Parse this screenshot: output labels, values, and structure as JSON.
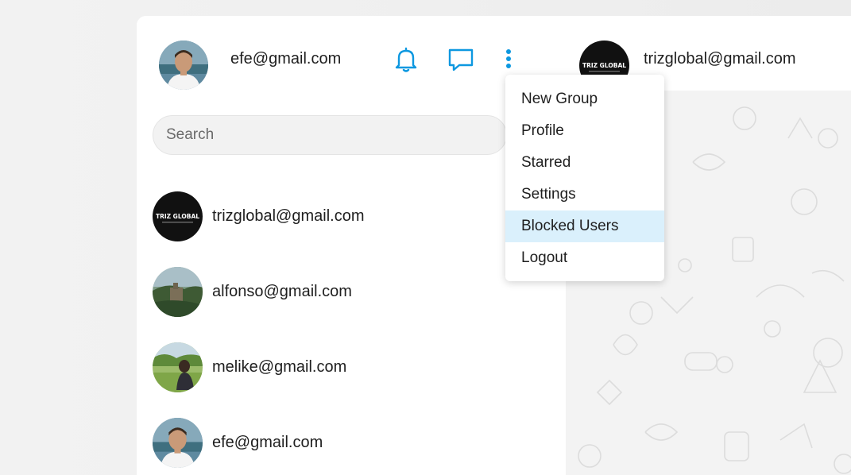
{
  "user": {
    "email": "efe@gmail.com"
  },
  "header": {
    "icons": [
      "bell-icon",
      "chat-bubble-icon",
      "more-vertical-icon"
    ],
    "accent_color": "#0d98e0"
  },
  "search": {
    "placeholder": "Search",
    "value": ""
  },
  "contacts": [
    {
      "email": "trizglobal@gmail.com",
      "avatar_text": "TRIZ GLOBAL"
    },
    {
      "email": "alfonso@gmail.com"
    },
    {
      "email": "melike@gmail.com"
    },
    {
      "email": "efe@gmail.com"
    }
  ],
  "chat": {
    "contact_email": "trizglobal@gmail.com",
    "contact_avatar_text": "TRIZ GLOBAL"
  },
  "menu": {
    "items": [
      "New Group",
      "Profile",
      "Starred",
      "Settings",
      "Blocked Users",
      "Logout"
    ],
    "highlighted": "Blocked Users",
    "highlight_color": "#daf0fc"
  }
}
